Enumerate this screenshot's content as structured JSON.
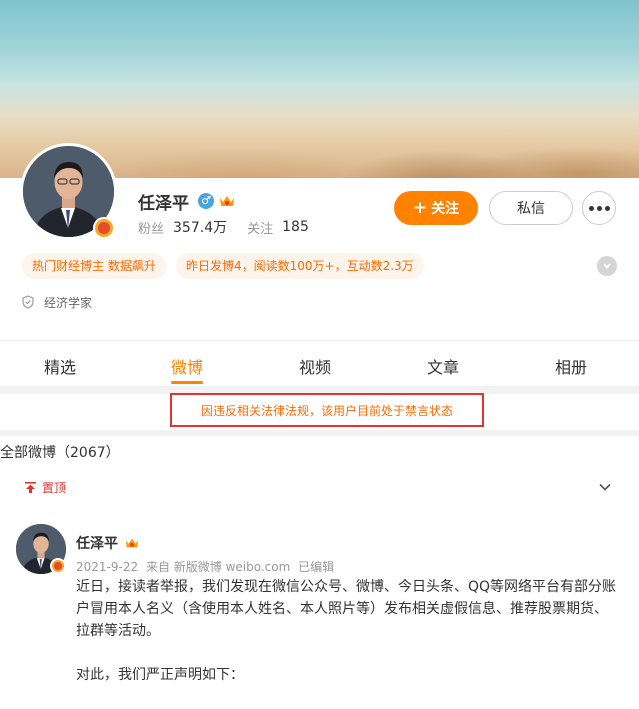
{
  "profile": {
    "name": "任泽平",
    "followers_label": "粉丝",
    "followers_value": "357.4万",
    "following_label": "关注",
    "following_value": "185",
    "follow_button": "关注",
    "message_button": "私信",
    "tags": [
      "热门财经博主 数据飙升",
      "昨日发博4，阅读数100万+，互动数2.3万"
    ],
    "occupation": "经济学家"
  },
  "tabs": [
    {
      "label": "精选"
    },
    {
      "label": "微博"
    },
    {
      "label": "视频"
    },
    {
      "label": "文章"
    },
    {
      "label": "相册"
    }
  ],
  "active_tab": "微博",
  "notice": "因违反相关法律法规，该用户目前处于禁言状态",
  "feed": {
    "all_label": "全部微博（2067）",
    "pinned_label": "置顶"
  },
  "post": {
    "author": "任泽平",
    "date": "2021-9-22",
    "source": "来自 新版微博 weibo.com",
    "edited": "已编辑",
    "paragraph1": "近日，接读者举报，我们发现在微信公众号、微博、今日头条、QQ等网络平台有部分账户冒用本人名义（含使用本人姓名、本人照片等）发布相关虚假信息、推荐股票期货、拉群等活动。",
    "paragraph2": "对此，我们严正声明如下："
  },
  "colors": {
    "accent": "#ff8200",
    "notice_border": "#e8322f",
    "tag_bg": "#fff4ec",
    "tag_text": "#ff6a00"
  }
}
